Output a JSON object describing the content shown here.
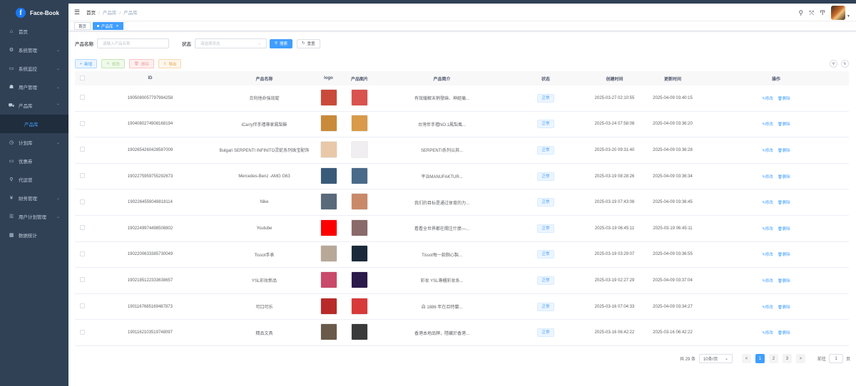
{
  "app": {
    "title": "Face-Book",
    "logo_letter": "f"
  },
  "sidebar": {
    "items": [
      {
        "label": "首页",
        "icon": "home-icon",
        "glyph": "⌂",
        "arrow": ""
      },
      {
        "label": "系统管理",
        "icon": "gear-icon",
        "glyph": "⚙",
        "arrow": "⌄"
      },
      {
        "label": "系统监控",
        "icon": "monitor-icon",
        "glyph": "▭",
        "arrow": "⌄"
      },
      {
        "label": "用户管理",
        "icon": "user-icon",
        "glyph": "☗",
        "arrow": "⌄"
      },
      {
        "label": "产品库",
        "icon": "cart-icon",
        "glyph": "⛟",
        "arrow": "⌃"
      }
    ],
    "active_sub": "产品库",
    "items_after": [
      {
        "label": "计划库",
        "icon": "clock-icon",
        "glyph": "◷",
        "arrow": "⌄"
      },
      {
        "label": "优惠券",
        "icon": "coupon-icon",
        "glyph": "▭",
        "arrow": ""
      },
      {
        "label": "代运营",
        "icon": "link-icon",
        "glyph": "⚲",
        "arrow": ""
      },
      {
        "label": "财务管理",
        "icon": "yen-icon",
        "glyph": "¥",
        "arrow": "⌄"
      },
      {
        "label": "用户计划管理",
        "icon": "list-icon",
        "glyph": "☰",
        "arrow": "⌄"
      },
      {
        "label": "数据统计",
        "icon": "chart-icon",
        "glyph": "▦",
        "arrow": ""
      }
    ]
  },
  "breadcrumb": {
    "home": "首页",
    "level1": "产品库",
    "current": "产品库"
  },
  "tags": {
    "home": "首页",
    "active": "产品库"
  },
  "search": {
    "name_label": "产品名称",
    "name_placeholder": "请输入产品名称",
    "status_label": "状态",
    "status_placeholder": "请选择状态",
    "search_btn": "搜索",
    "reset_btn": "重置"
  },
  "toolbar": {
    "add": "新增",
    "edit": "修改",
    "delete": "删除",
    "export": "导出"
  },
  "table": {
    "headers": {
      "id": "ID",
      "name": "产品名称",
      "logo": "logo",
      "image": "产品图片",
      "intro": "产品简介",
      "status": "状态",
      "created": "创建时间",
      "updated": "更新时间",
      "ops": "操作"
    },
    "op_edit": "修改",
    "op_delete": "删除",
    "rows": [
      {
        "id": "1905080057797984258",
        "name": "合利他命強效錠",
        "intro": "有效緩解末梢發麻、神經痛...",
        "status": "正常",
        "created": "2025-03-27 02:10:55",
        "updated": "2025-04-09 03:40:15",
        "logo_color": "#c94a3a",
        "img_color": "#d9534f"
      },
      {
        "id": "1904080274908168194",
        "name": "iCarry伴手禮專家鳳梨酥",
        "intro": "台灣伴手禮NO.1鳳梨風...",
        "status": "正常",
        "created": "2025-03-24 07:58:08",
        "updated": "2025-04-09 03:36:20",
        "logo_color": "#c98a3a",
        "img_color": "#d99a4a"
      },
      {
        "id": "1902654260428587009",
        "name": "Bulgari SERPENTI INFINITO灵蛇系列珠宝配饰",
        "intro": "SERPENTI系列以其...",
        "status": "正常",
        "created": "2025-03-20 09:31:40",
        "updated": "2025-04-09 03:36:28",
        "logo_color": "#e8c8a8",
        "img_color": "#f0eef0"
      },
      {
        "id": "1902275959755292673",
        "name": "Mercedes-Benz -AMG G63",
        "intro": "平治MANUFAKTUR...",
        "status": "正常",
        "created": "2025-03-19 08:28:26",
        "updated": "2025-04-09 03:36:34",
        "logo_color": "#3a5a7a",
        "img_color": "#4a6a8a"
      },
      {
        "id": "1902264559049818114",
        "name": "Nike",
        "intro": "我们的目标是通过体育的力...",
        "status": "正常",
        "created": "2025-03-19 07:43:08",
        "updated": "2025-04-09 03:36:45",
        "logo_color": "#5a6a7a",
        "img_color": "#c98a6a"
      },
      {
        "id": "1902249974498508802",
        "name": "Youtube",
        "intro": "看看全世界都在關注什麼—...",
        "status": "正常",
        "created": "2025-03-19 06:45:11",
        "updated": "2025-03-19 06:45:11",
        "logo_color": "#ff0000",
        "img_color": "#8a6a6a"
      },
      {
        "id": "1902200633385730049",
        "name": "Tissot手表",
        "intro": "Tissot每一款腕心製...",
        "status": "正常",
        "created": "2025-03-19 03:29:07",
        "updated": "2025-04-09 03:36:55",
        "logo_color": "#b8a898",
        "img_color": "#1a2a3a"
      },
      {
        "id": "1902185122333638657",
        "name": "YSL彩妆新品",
        "intro": "彩妆 YSL專櫃彩妆系...",
        "status": "正常",
        "created": "2025-03-19 02:27:29",
        "updated": "2025-04-09 03:37:04",
        "logo_color": "#c94a6a",
        "img_color": "#2a1a4a"
      },
      {
        "id": "1901167685169487873",
        "name": "可口可乐",
        "intro": "自 1886 年在亞特蘭...",
        "status": "正常",
        "created": "2025-03-16 07:04:33",
        "updated": "2025-04-09 03:34:27",
        "logo_color": "#b82a2a",
        "img_color": "#d83a3a"
      },
      {
        "id": "1901162103519748097",
        "name": "精品文具",
        "intro": "香港本地品牌，隱藏於香港...",
        "status": "正常",
        "created": "2025-03-16 06:42:22",
        "updated": "2025-03-16 06:42:22",
        "logo_color": "#6a5a4a",
        "img_color": "#3a3a3a"
      }
    ]
  },
  "pager": {
    "total": "共 29 条",
    "size": "10条/页",
    "prev": "<",
    "next": ">",
    "pages": [
      "1",
      "2",
      "3"
    ],
    "goto_label": "前往",
    "goto_value": "1",
    "goto_unit": "页"
  }
}
